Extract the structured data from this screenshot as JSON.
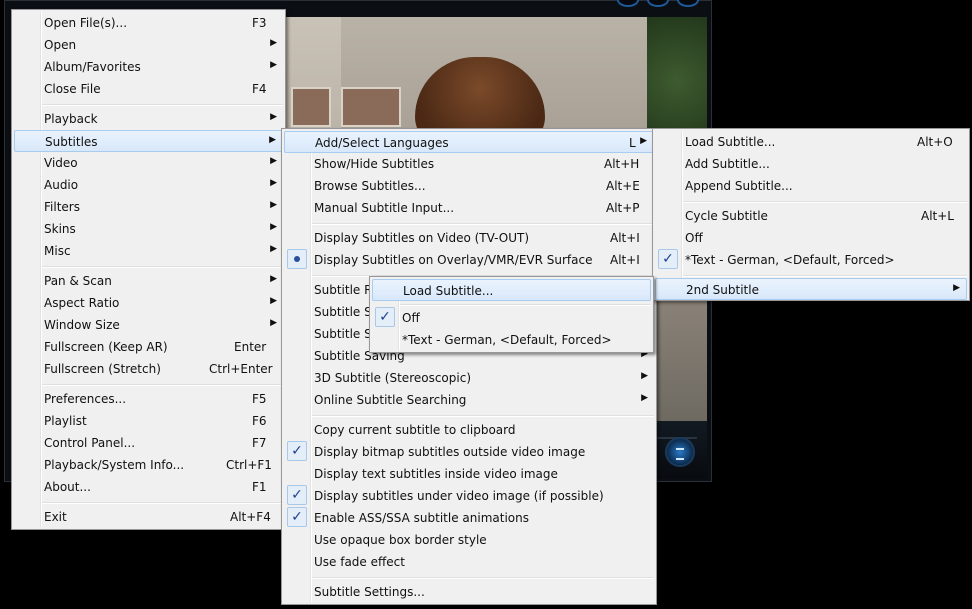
{
  "main_menu": {
    "items": [
      {
        "label": "Open File(s)...",
        "shortcut": "F3"
      },
      {
        "label": "Open",
        "shortcut": ""
      },
      {
        "label": "Album/Favorites",
        "shortcut": ""
      },
      {
        "label": "Close File",
        "shortcut": "F4"
      },
      {
        "label": "Playback",
        "shortcut": ""
      },
      {
        "label": "Subtitles",
        "shortcut": ""
      },
      {
        "label": "Video",
        "shortcut": ""
      },
      {
        "label": "Audio",
        "shortcut": ""
      },
      {
        "label": "Filters",
        "shortcut": ""
      },
      {
        "label": "Skins",
        "shortcut": ""
      },
      {
        "label": "Misc",
        "shortcut": ""
      },
      {
        "label": "Pan & Scan",
        "shortcut": ""
      },
      {
        "label": "Aspect Ratio",
        "shortcut": ""
      },
      {
        "label": "Window Size",
        "shortcut": ""
      },
      {
        "label": "Fullscreen (Keep AR)",
        "shortcut": "Enter"
      },
      {
        "label": "Fullscreen (Stretch)",
        "shortcut": "Ctrl+Enter"
      },
      {
        "label": "Preferences...",
        "shortcut": "F5"
      },
      {
        "label": "Playlist",
        "shortcut": "F6"
      },
      {
        "label": "Control Panel...",
        "shortcut": "F7"
      },
      {
        "label": "Playback/System Info...",
        "shortcut": "Ctrl+F1"
      },
      {
        "label": "About...",
        "shortcut": "F1"
      },
      {
        "label": "Exit",
        "shortcut": "Alt+F4"
      }
    ]
  },
  "subtitles_menu": {
    "items": [
      {
        "label": "Add/Select Languages",
        "shortcut": "L"
      },
      {
        "label": "Show/Hide Subtitles",
        "shortcut": "Alt+H"
      },
      {
        "label": "Browse Subtitles...",
        "shortcut": "Alt+E"
      },
      {
        "label": "Manual Subtitle Input...",
        "shortcut": "Alt+P"
      },
      {
        "label": "Display Subtitles on Video (TV-OUT)",
        "shortcut": "Alt+I"
      },
      {
        "label": "Display Subtitles on Overlay/VMR/EVR Surface",
        "shortcut": "Alt+I"
      },
      {
        "label": "Subtitle R",
        "shortcut": ""
      },
      {
        "label": "Subtitle S",
        "shortcut": ""
      },
      {
        "label": "Subtitle S",
        "shortcut": ""
      },
      {
        "label": "Subtitle Saving",
        "shortcut": ""
      },
      {
        "label": "3D Subtitle (Stereoscopic)",
        "shortcut": ""
      },
      {
        "label": "Online Subtitle Searching",
        "shortcut": ""
      },
      {
        "label": "Copy current subtitle to clipboard",
        "shortcut": ""
      },
      {
        "label": "Display bitmap subtitles outside video image",
        "shortcut": ""
      },
      {
        "label": "Display text subtitles inside video image",
        "shortcut": ""
      },
      {
        "label": "Display subtitles under video image (if possible)",
        "shortcut": ""
      },
      {
        "label": "Enable ASS/SSA subtitle animations",
        "shortcut": ""
      },
      {
        "label": "Use opaque box border style",
        "shortcut": ""
      },
      {
        "label": "Use fade effect",
        "shortcut": ""
      },
      {
        "label": "Subtitle Settings...",
        "shortcut": ""
      }
    ]
  },
  "languages_menu": {
    "items": [
      {
        "label": "Load Subtitle...",
        "shortcut": "Alt+O"
      },
      {
        "label": "Add Subtitle...",
        "shortcut": ""
      },
      {
        "label": "Append Subtitle...",
        "shortcut": ""
      },
      {
        "label": "Cycle Subtitle",
        "shortcut": "Alt+L"
      },
      {
        "label": "Off",
        "shortcut": ""
      },
      {
        "label": "*Text - German, <Default, Forced>",
        "shortcut": ""
      },
      {
        "label": "2nd Subtitle",
        "shortcut": ""
      }
    ]
  },
  "second_subtitle_menu": {
    "items": [
      {
        "label": "Load Subtitle..."
      },
      {
        "label": "Off"
      },
      {
        "label": "*Text - German, <Default, Forced>"
      }
    ]
  },
  "glyphs": {
    "arrow": "▶",
    "check": "✓"
  },
  "colors": {
    "highlight_border": "#a8cbf0",
    "check_color": "#1f3f8f",
    "player_accent": "#1e5a9a"
  }
}
